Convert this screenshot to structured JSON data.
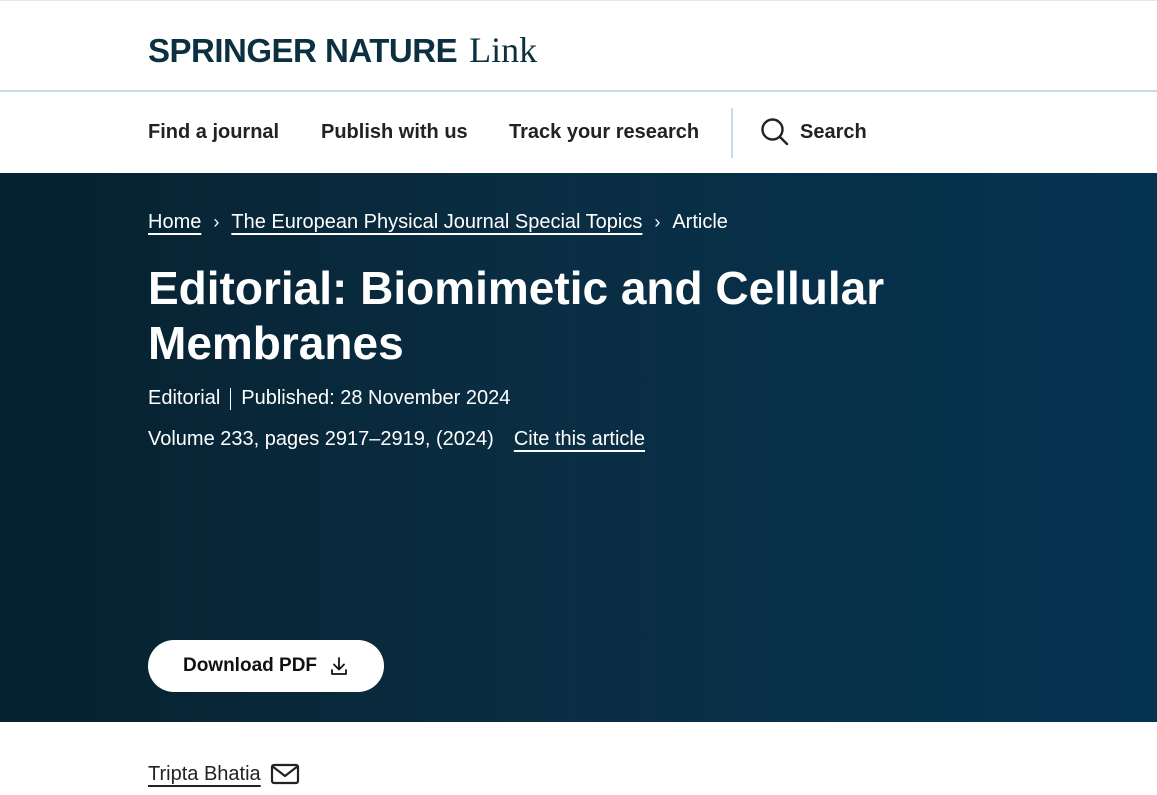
{
  "header": {
    "logo_main": "SPRINGER NATURE",
    "logo_link": "Link"
  },
  "nav": {
    "items": [
      "Find a journal",
      "Publish with us",
      "Track your research"
    ],
    "search_label": "Search",
    "search_icon": "search-icon"
  },
  "breadcrumb": {
    "home": "Home",
    "journal": "The European Physical Journal Special Topics",
    "current": "Article"
  },
  "article": {
    "title": "Editorial: Biomimetic and Cellular Membranes",
    "type": "Editorial",
    "published": "Published: 28 November 2024",
    "volume_info": "Volume 233, pages 2917–2919, (2024)",
    "cite_label": "Cite this article"
  },
  "download": {
    "label": "Download PDF",
    "icon": "download-icon"
  },
  "author": {
    "name": "Tripta Bhatia",
    "icon": "mail-icon"
  },
  "colors": {
    "brand_dark": "#0b3140",
    "hero_start": "#06212f",
    "hero_end": "#043350",
    "divider": "#c7dde8"
  }
}
